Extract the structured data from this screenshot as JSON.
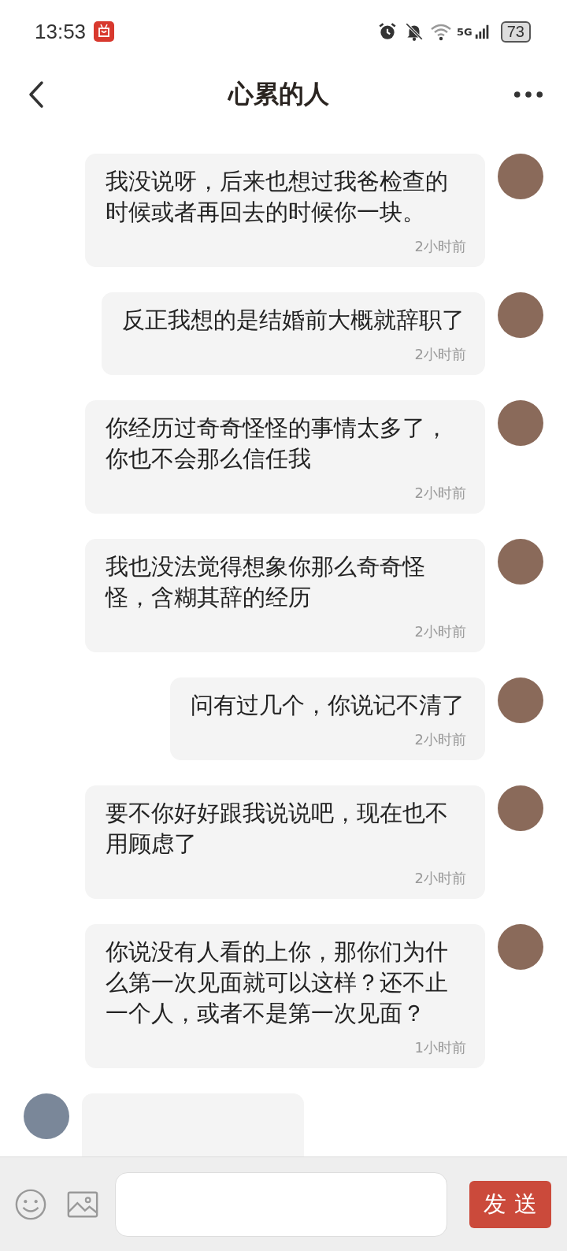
{
  "status_bar": {
    "time": "13:53",
    "network": "5G",
    "battery": "73"
  },
  "header": {
    "title": "心累的人"
  },
  "messages": [
    {
      "kind": "sent",
      "text": "我没说呀，后来也想过我爸检查的时候或者再回去的时候你一块。",
      "time": "2小时前"
    },
    {
      "kind": "sent",
      "text": "反正我想的是结婚前大概就辞职了",
      "time": "2小时前"
    },
    {
      "kind": "sent",
      "text": "你经历过奇奇怪怪的事情太多了，你也不会那么信任我",
      "time": "2小时前"
    },
    {
      "kind": "sent",
      "text": "我也没法觉得想象你那么奇奇怪怪，含糊其辞的经历",
      "time": "2小时前"
    },
    {
      "kind": "sent",
      "text": "问有过几个，你说记不清了",
      "time": "2小时前"
    },
    {
      "kind": "sent",
      "text": "要不你好好跟我说说吧，现在也不用顾虑了",
      "time": "2小时前"
    },
    {
      "kind": "sent",
      "text": "你说没有人看的上你，那你们为什么第一次见面就可以这样？还不止一个人，或者不是第一次见面？",
      "time": "1小时前"
    },
    {
      "kind": "received"
    }
  ],
  "composer": {
    "send": "发 送"
  }
}
